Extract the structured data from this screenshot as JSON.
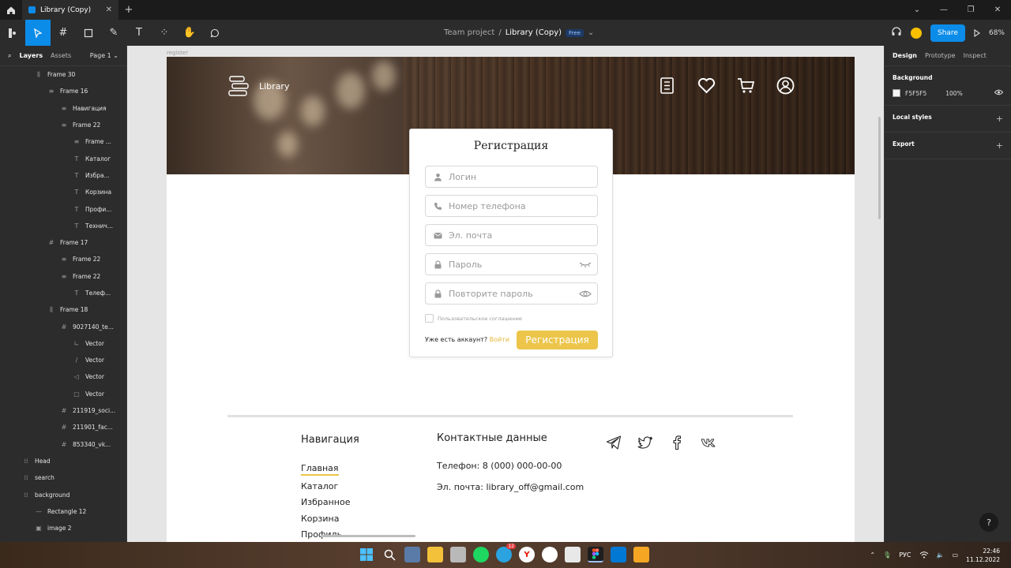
{
  "window": {
    "tab_title": "Library (Copy)",
    "new_tab": "+"
  },
  "toolbar": {
    "project": "Team project",
    "separator": "/",
    "file": "Library (Copy)",
    "plan_badge": "Free",
    "share_label": "Share",
    "zoom": "68%"
  },
  "layers_panel": {
    "tabs": [
      "Layers",
      "Assets"
    ],
    "page": "Page 1",
    "items": [
      {
        "glyph": "⫼",
        "label": "Frame 30",
        "indent": 1
      },
      {
        "glyph": "≡",
        "label": "Frame 16",
        "indent": 2
      },
      {
        "glyph": "≡",
        "label": "Навигация",
        "indent": 3
      },
      {
        "glyph": "≡",
        "label": "Frame 22",
        "indent": 3
      },
      {
        "glyph": "≡",
        "label": "Frame ...",
        "indent": 4
      },
      {
        "glyph": "T",
        "label": "Каталог",
        "indent": 4
      },
      {
        "glyph": "T",
        "label": "Избра...",
        "indent": 4
      },
      {
        "glyph": "T",
        "label": "Корзина",
        "indent": 4
      },
      {
        "glyph": "T",
        "label": "Профи...",
        "indent": 4
      },
      {
        "glyph": "T",
        "label": "Технич...",
        "indent": 4
      },
      {
        "glyph": "#",
        "label": "Frame 17",
        "indent": 2
      },
      {
        "glyph": "≡",
        "label": "Frame 22",
        "indent": 3
      },
      {
        "glyph": "≡",
        "label": "Frame 22",
        "indent": 3
      },
      {
        "glyph": "T",
        "label": "Телеф...",
        "indent": 4
      },
      {
        "glyph": "⫼",
        "label": "Frame 18",
        "indent": 2
      },
      {
        "glyph": "#",
        "label": "9027140_te...",
        "indent": 3
      },
      {
        "glyph": "∟",
        "label": "Vector",
        "indent": 4
      },
      {
        "glyph": "/",
        "label": "Vector",
        "indent": 4
      },
      {
        "glyph": "◁",
        "label": "Vector",
        "indent": 4
      },
      {
        "glyph": "▢",
        "label": "Vector",
        "indent": 4
      },
      {
        "glyph": "#",
        "label": "211919_soci...",
        "indent": 3
      },
      {
        "glyph": "#",
        "label": "211901_fac...",
        "indent": 3
      },
      {
        "glyph": "#",
        "label": "853340_vk...",
        "indent": 3
      },
      {
        "glyph": "⁞⁞",
        "label": "Head",
        "indent": 0
      },
      {
        "glyph": "⁞⁞",
        "label": "search",
        "indent": 0
      },
      {
        "glyph": "⁞⁞",
        "label": "background",
        "indent": 0
      },
      {
        "glyph": "—",
        "label": "Rectangle 12",
        "indent": 1
      },
      {
        "glyph": "▣",
        "label": "image 2",
        "indent": 1
      }
    ]
  },
  "canvas": {
    "frame_label": "register",
    "logo_text": "Library",
    "register_form": {
      "title": "Регистрация",
      "login_placeholder": "Логин",
      "phone_placeholder": "Номер телефона",
      "email_placeholder": "Эл. почта",
      "password_placeholder": "Пароль",
      "repeat_password_placeholder": "Повторите пароль",
      "agreement_label": "Пользовательское соглашение",
      "have_account": "Уже есть аккаунт?",
      "login_link": "Войти",
      "submit_label": "Регистрация"
    },
    "footer": {
      "nav_heading": "Навигация",
      "nav_links": [
        "Главная",
        "Каталог",
        "Избранное",
        "Корзина",
        "Профиль"
      ],
      "contacts_heading": "Контактные данные",
      "phone": "Телефон: 8 (000) 000-00-00",
      "email": "Эл. почта: library_off@gmail.com"
    },
    "accent_color": "#ECC54A"
  },
  "properties_panel": {
    "tabs": [
      "Design",
      "Prototype",
      "Inspect"
    ],
    "background_title": "Background",
    "background_hex": "F5F5F5",
    "background_opacity": "100%",
    "local_styles": "Local styles",
    "export": "Export",
    "help": "?"
  },
  "taskbar": {
    "language": "РУС",
    "time": "22:46",
    "date": "11.12.2022",
    "telegram_badge": "12"
  }
}
